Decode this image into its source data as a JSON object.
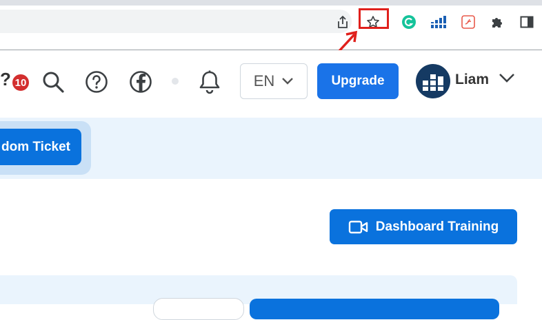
{
  "browser": {
    "toolbar_icons": [
      "share-icon",
      "star-icon",
      "grammarly-icon",
      "chart-extension-icon",
      "pdf-extension-icon",
      "puzzle-icon",
      "sidepanel-icon"
    ],
    "highlight_color": "#e0201c"
  },
  "header": {
    "notification_count": "10",
    "partial_char": "?",
    "language": "EN",
    "upgrade_label": "Upgrade",
    "user_name": "Liam"
  },
  "banner": {
    "ticket_label": "dom Ticket"
  },
  "main": {
    "dashboard_training_label": "Dashboard Training"
  },
  "colors": {
    "primary": "#0a72dd",
    "banner_bg": "#eaf4fd",
    "badge": "#d32f2f"
  }
}
